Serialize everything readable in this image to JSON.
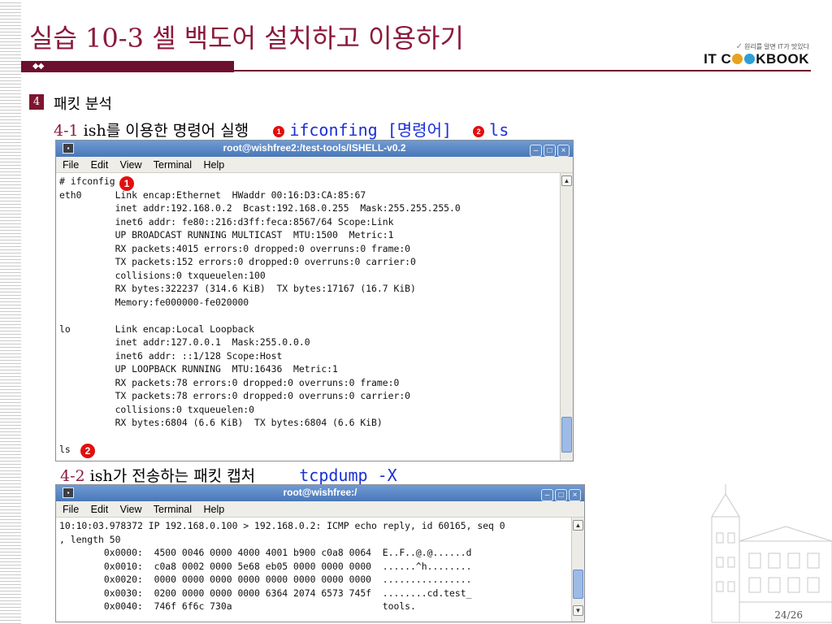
{
  "slide": {
    "title": "실습 10-3 셸 백도어 설치하고 이용하기",
    "page": "24/26"
  },
  "logo": {
    "tagline": "원리를 알면 IT가 맛있다",
    "brand_left": "IT C",
    "brand_right": "KBOOK",
    "dot_colors": [
      "#e8a21c",
      "#2f9fd6"
    ]
  },
  "section": {
    "number": "4",
    "title": "패킷 분석"
  },
  "sub1": {
    "num": "4-1",
    "text": "ish를 이용한 명령어 실행",
    "marker1": "1",
    "cmd1": "ifconfing [명령어]",
    "marker2": "2",
    "cmd2": "ls"
  },
  "sub2": {
    "num": "4-2",
    "text": "ish가 전송하는 패킷 캡처",
    "cmd": "tcpdump -X"
  },
  "terminal1": {
    "title": "root@wishfree2:/test-tools/ISHELL-v0.2",
    "menu": [
      "File",
      "Edit",
      "View",
      "Terminal",
      "Help"
    ],
    "lines": [
      "# ifconfig",
      "eth0      Link encap:Ethernet  HWaddr 00:16:D3:CA:85:67",
      "          inet addr:192.168.0.2  Bcast:192.168.0.255  Mask:255.255.255.0",
      "          inet6 addr: fe80::216:d3ff:feca:8567/64 Scope:Link",
      "          UP BROADCAST RUNNING MULTICAST  MTU:1500  Metric:1",
      "          RX packets:4015 errors:0 dropped:0 overruns:0 frame:0",
      "          TX packets:152 errors:0 dropped:0 overruns:0 carrier:0",
      "          collisions:0 txqueuelen:100",
      "          RX bytes:322237 (314.6 KiB)  TX bytes:17167 (16.7 KiB)",
      "          Memory:fe000000-fe020000",
      "",
      "lo        Link encap:Local Loopback",
      "          inet addr:127.0.0.1  Mask:255.0.0.0",
      "          inet6 addr: ::1/128 Scope:Host",
      "          UP LOOPBACK RUNNING  MTU:16436  Metric:1",
      "          RX packets:78 errors:0 dropped:0 overruns:0 frame:0",
      "          TX packets:78 errors:0 dropped:0 overruns:0 carrier:0",
      "          collisions:0 txqueuelen:0",
      "          RX bytes:6804 (6.6 KiB)  TX bytes:6804 (6.6 KiB)",
      "",
      "ls"
    ],
    "marker1": "1",
    "marker2": "2"
  },
  "terminal2": {
    "title": "root@wishfree:/",
    "menu": [
      "File",
      "Edit",
      "View",
      "Terminal",
      "Help"
    ],
    "lines": [
      "10:10:03.978372 IP 192.168.0.100 > 192.168.0.2: ICMP echo reply, id 60165, seq 0",
      ", length 50",
      "        0x0000:  4500 0046 0000 4000 4001 b900 c0a8 0064  E..F..@.@......d",
      "        0x0010:  c0a8 0002 0000 5e68 eb05 0000 0000 0000  ......^h........",
      "        0x0020:  0000 0000 0000 0000 0000 0000 0000 0000  ................",
      "        0x0030:  0200 0000 0000 0000 6364 2074 6573 745f  ........cd.test_",
      "        0x0040:  746f 6f6c 730a                           tools."
    ]
  }
}
